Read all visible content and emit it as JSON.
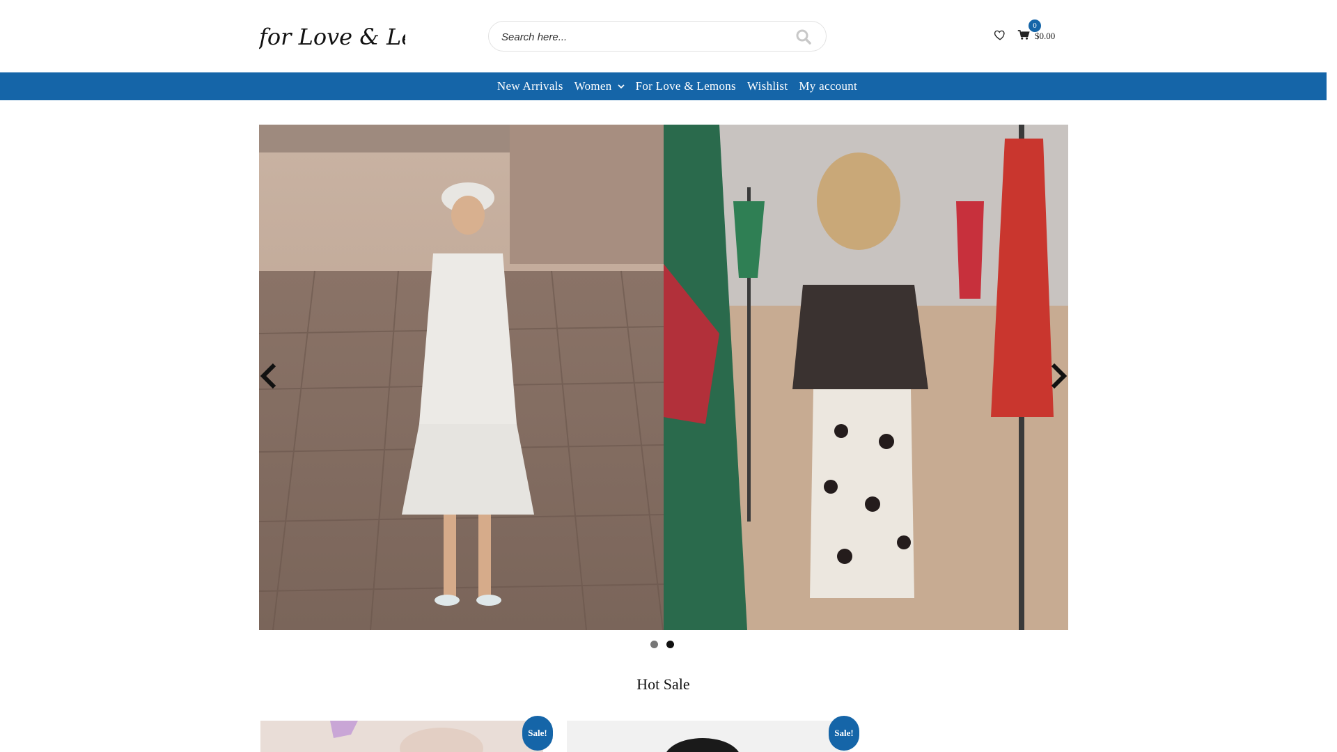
{
  "header": {
    "logo_text": "for Love & Lemons",
    "search_placeholder": "Search here...",
    "cart_count": "0",
    "cart_total": "$0.00"
  },
  "nav": {
    "items": [
      {
        "label": "New Arrivals"
      },
      {
        "label": "Women"
      },
      {
        "label": "For Love & Lemons"
      },
      {
        "label": "Wishlist"
      },
      {
        "label": "My account"
      }
    ]
  },
  "slider": {
    "active_dot": 2,
    "dot_count": 2
  },
  "section": {
    "title": "Hot Sale"
  },
  "products": [
    {
      "badge": "Sale!"
    },
    {
      "badge": "Sale!"
    }
  ],
  "colors": {
    "brand_blue": "#1565a8"
  }
}
